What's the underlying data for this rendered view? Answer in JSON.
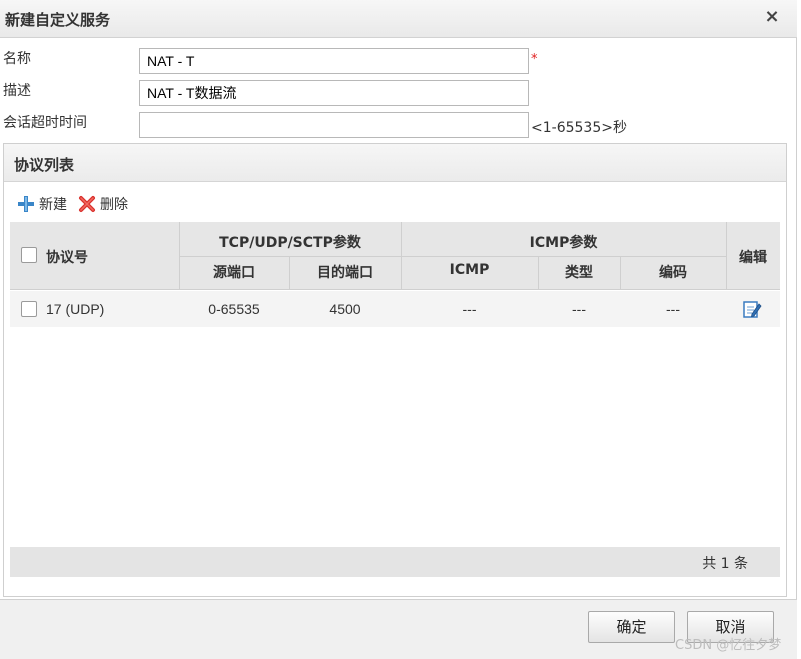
{
  "dialog": {
    "title": "新建自定义服务",
    "close_glyph": "×"
  },
  "form": {
    "name_label": "名称",
    "name_value": "NAT - T",
    "required_mark": "*",
    "desc_label": "描述",
    "desc_value": "NAT - T数据流",
    "timeout_label": "会话超时时间",
    "timeout_value": "",
    "timeout_hint": "<1-65535>秒"
  },
  "protocol_panel": {
    "title": "协议列表",
    "toolbar": {
      "new_label": "新建",
      "new_icon": "plus-icon",
      "delete_label": "删除",
      "delete_icon": "delete-x-icon"
    },
    "table": {
      "headers": {
        "protocol": "协议号",
        "tcp_group": "TCP/UDP/SCTP参数",
        "src_port": "源端口",
        "dst_port": "目的端口",
        "icmp_group": "ICMP参数",
        "icmp": "ICMP",
        "type": "类型",
        "code": "编码",
        "edit": "编辑"
      },
      "rows": [
        {
          "protocol": "17 (UDP)",
          "src_port": "0-65535",
          "dst_port": "4500",
          "icmp": "---",
          "type": "---",
          "code": "---",
          "edit_icon": "edit-icon"
        }
      ]
    },
    "footer": {
      "count_text": "共 1 条"
    }
  },
  "buttons": {
    "ok_label": "确定",
    "cancel_label": "取消"
  },
  "watermark": "CSDN @忆往夕梦",
  "colors": {
    "required": "#e02020",
    "delete_icon": "#d9302c",
    "plus_icon": "#3a86c8",
    "edit_icon": "#3a7bc0"
  }
}
